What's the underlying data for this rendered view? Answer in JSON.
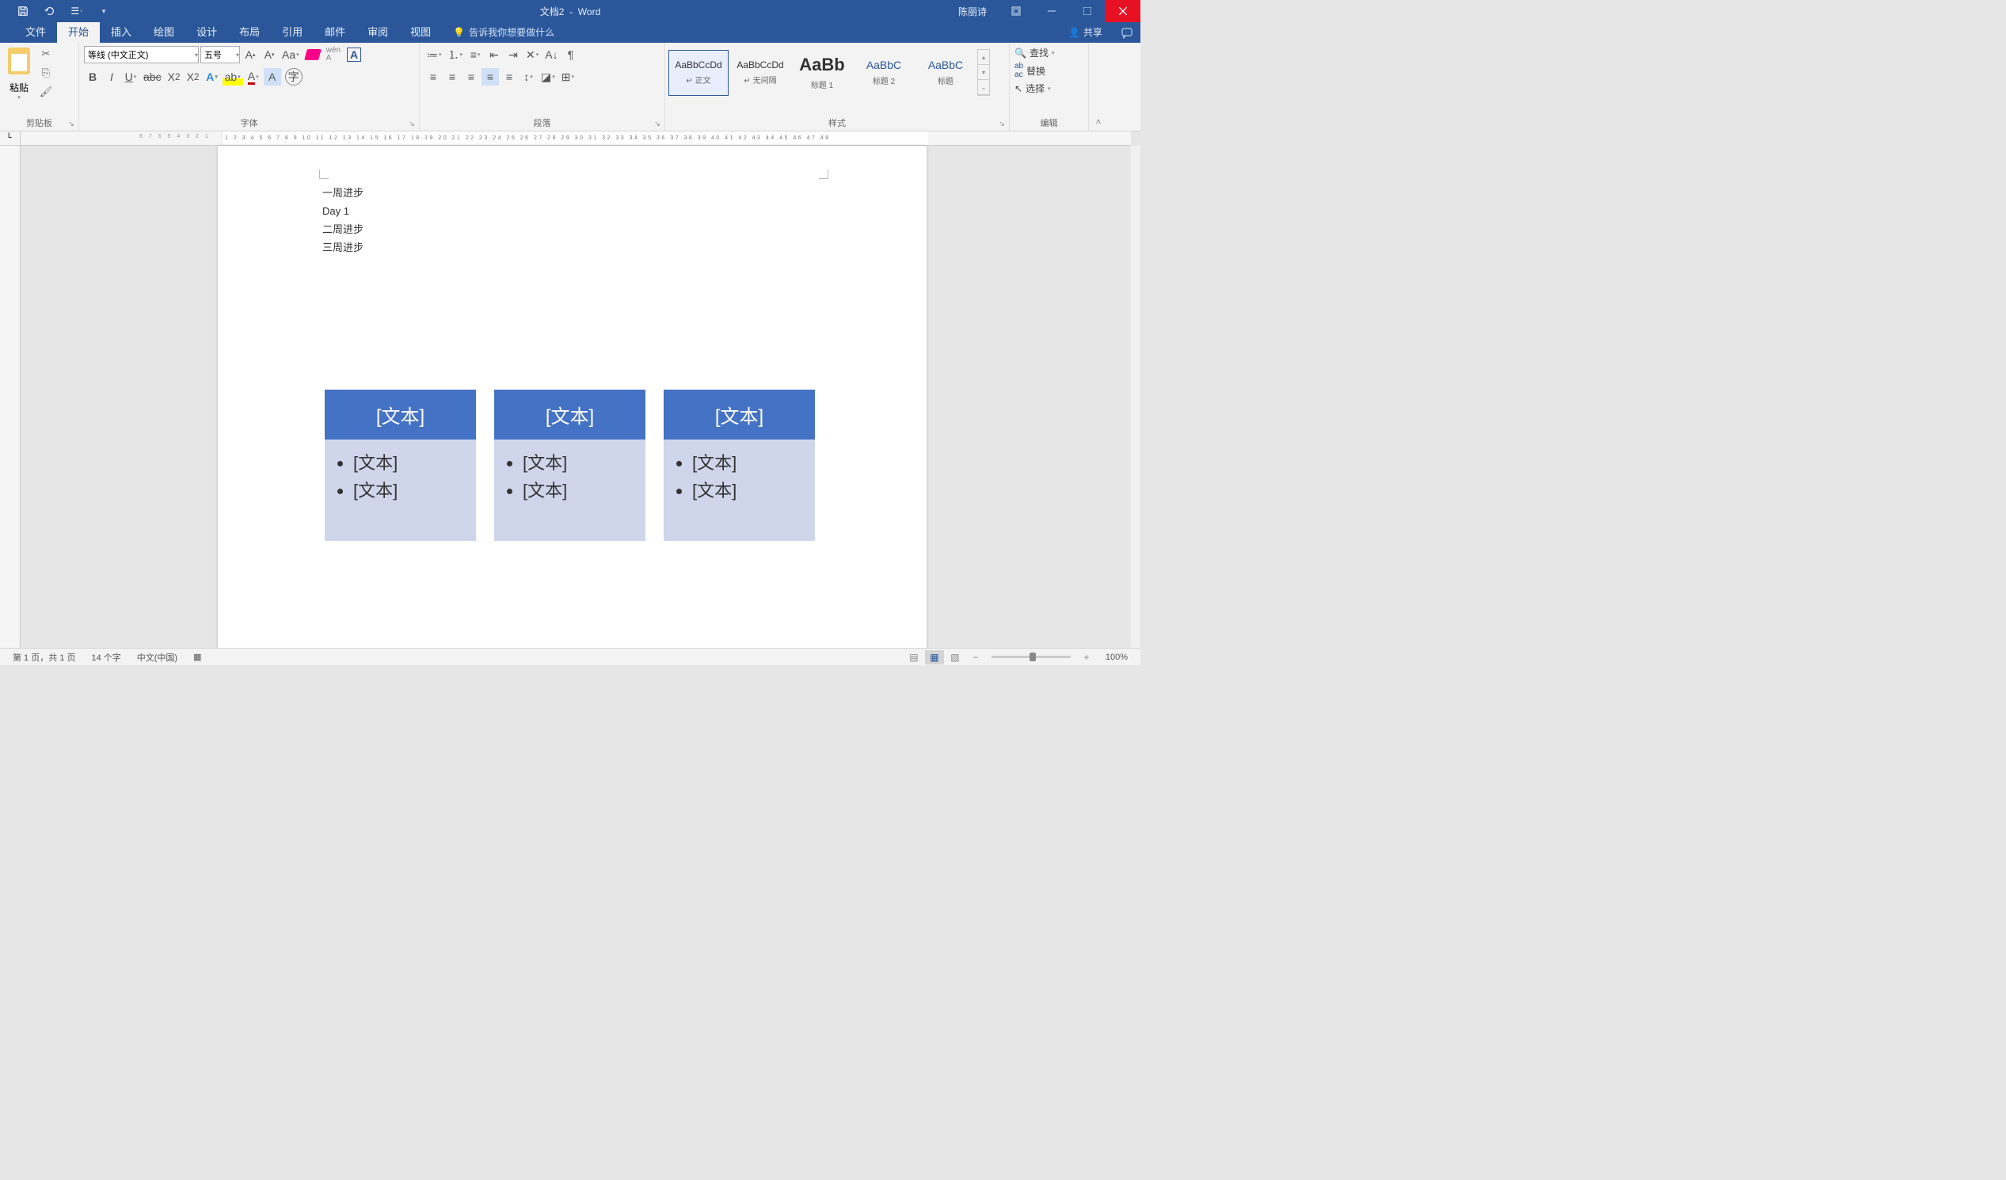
{
  "titlebar": {
    "doc": "文档2",
    "app": "Word",
    "user": "陈丽诗"
  },
  "tabs": {
    "items": [
      "文件",
      "开始",
      "插入",
      "绘图",
      "设计",
      "布局",
      "引用",
      "邮件",
      "审阅",
      "视图"
    ],
    "active": 1,
    "tellme": "告诉我你想要做什么",
    "share": "共享"
  },
  "ribbon": {
    "clipboard": {
      "paste": "粘贴",
      "label": "剪贴板"
    },
    "font": {
      "name": "等线 (中文正文)",
      "size": "五号",
      "label": "字体"
    },
    "paragraph": {
      "label": "段落"
    },
    "styles": {
      "label": "样式",
      "items": [
        {
          "preview": "AaBbCcDd",
          "name": "↵ 正文"
        },
        {
          "preview": "AaBbCcDd",
          "name": "↵ 无间隔"
        },
        {
          "preview": "AaBb",
          "name": "标题 1"
        },
        {
          "preview": "AaBbC",
          "name": "标题 2"
        },
        {
          "preview": "AaBbC",
          "name": "标题"
        }
      ]
    },
    "edit": {
      "find": "查找",
      "replace": "替换",
      "select": "选择",
      "label": "编辑"
    }
  },
  "document": {
    "lines": [
      "一周进步",
      "Day 1",
      "二周进步",
      "三周进步"
    ],
    "smartart": [
      {
        "title": "[文本]",
        "items": [
          "[文本]",
          "[文本]"
        ]
      },
      {
        "title": "[文本]",
        "items": [
          "[文本]",
          "[文本]"
        ]
      },
      {
        "title": "[文本]",
        "items": [
          "[文本]",
          "[文本]"
        ]
      }
    ]
  },
  "statusbar": {
    "page": "第 1 页，共 1 页",
    "words": "14 个字",
    "lang": "中文(中国)",
    "zoom": "100%"
  }
}
